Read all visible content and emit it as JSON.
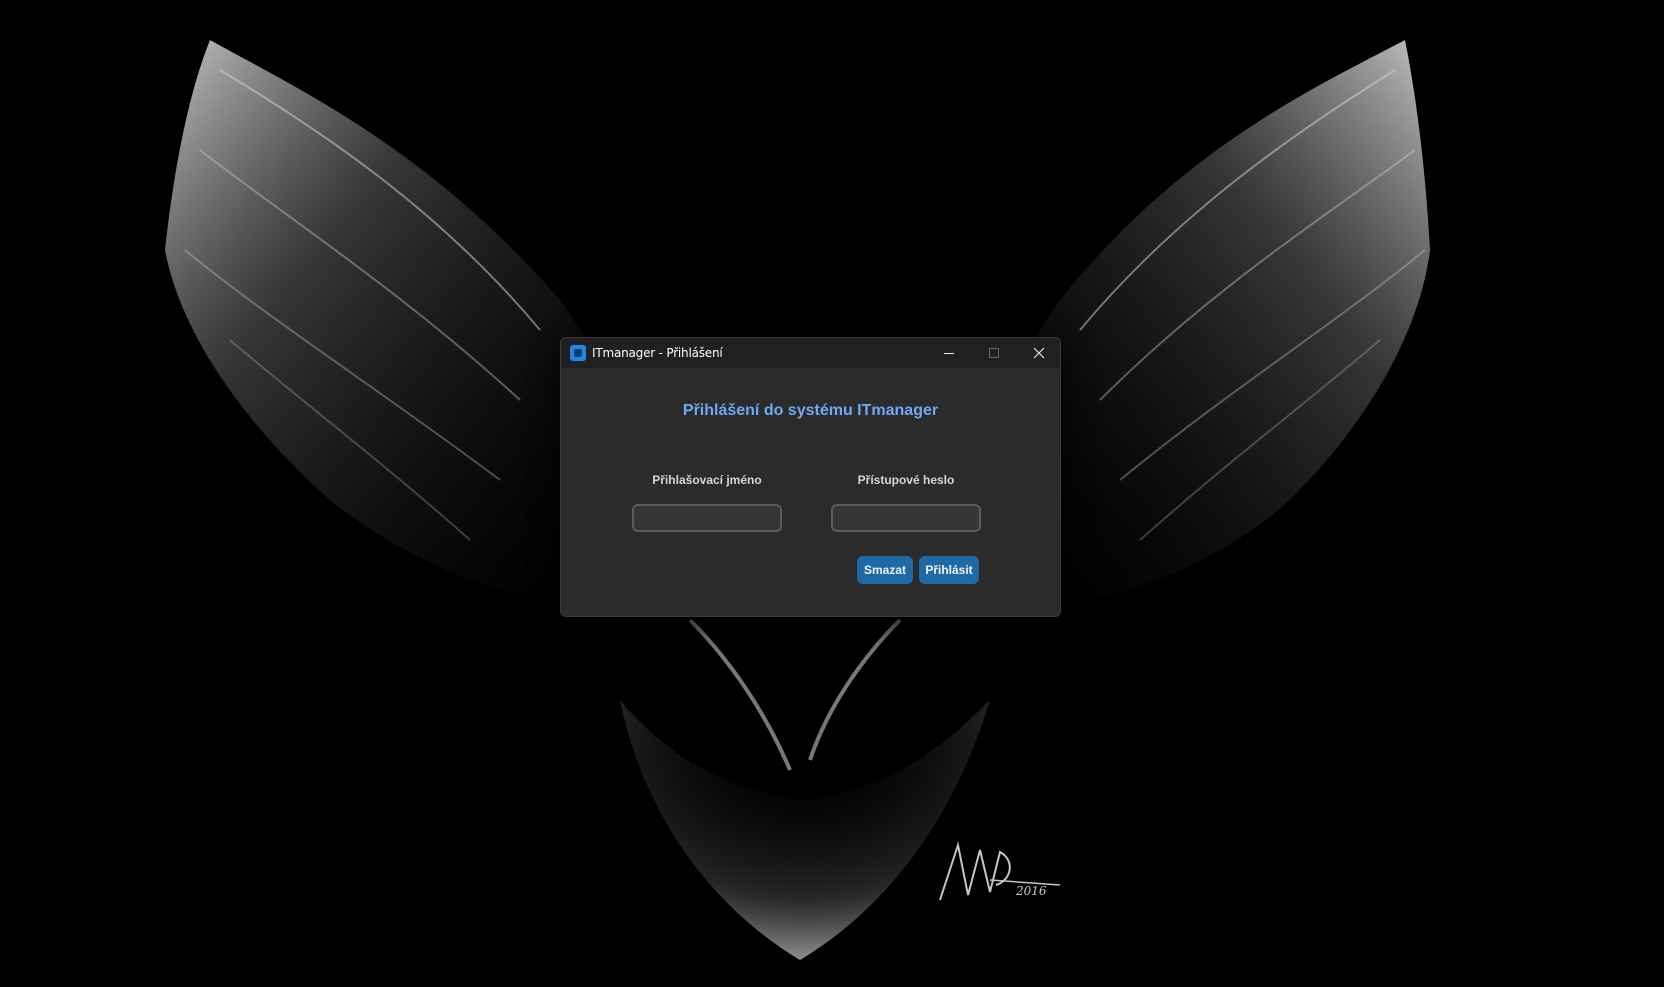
{
  "window": {
    "title": "ITmanager - Přihlášení",
    "controls": [
      "minimize-icon",
      "maximize-icon",
      "close-icon"
    ]
  },
  "login": {
    "heading": "Přihlášení do systému ITmanager",
    "username_label": "Přihlašovací jméno",
    "username_value": "",
    "password_label": "Přístupové heslo",
    "password_value": "",
    "clear_button": "Smazat",
    "login_button": "Přihlásit"
  },
  "wallpaper": {
    "signature": "ANGAD",
    "year": "2016"
  },
  "colors": {
    "accent": "#1f6aa5",
    "heading": "#6fa8f5",
    "window_bg": "#2b2b2b",
    "titlebar_bg": "#202020",
    "input_bg": "#343638"
  }
}
